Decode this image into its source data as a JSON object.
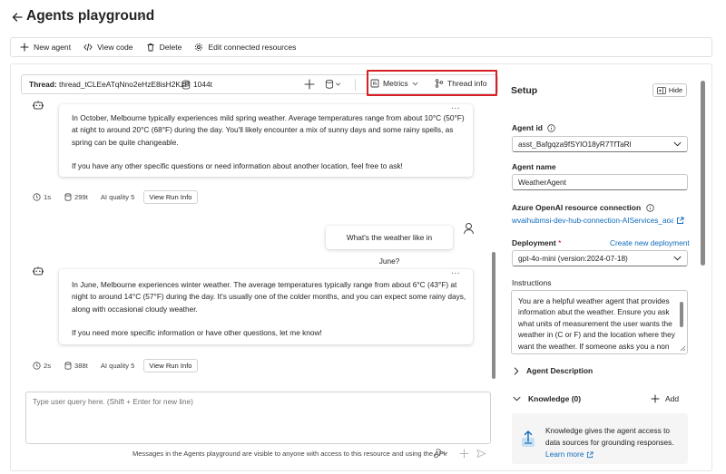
{
  "header": {
    "title": "Agents playground"
  },
  "toolbar": {
    "new_agent": "New agent",
    "view_code": "View code",
    "delete": "Delete",
    "edit_resources": "Edit connected resources"
  },
  "thread": {
    "label": "Thread:",
    "id": "thread_tCLEeATqNno2eHzE8isH2KzP",
    "tokens": "1044t",
    "metrics": "Metrics",
    "thread_info": "Thread info"
  },
  "messages": [
    {
      "role": "assistant",
      "more": "...",
      "paragraphs": [
        [
          "In October, Melbourne typically experiences mild spring weather. Average temperatures range from about 10°C (50°F)",
          "at night to around 20°C (68°F) during the day. You'll likely encounter a mix of sunny days and some rainy spells, as",
          "spring can be quite changeable."
        ],
        [
          "If you have any other specific questions or need information about another location, feel free to ask!"
        ]
      ],
      "duration": "1s",
      "tokens": "299t",
      "ai_quality": "AI quality 5",
      "run_info": "View Run Info"
    },
    {
      "role": "user",
      "text": "What's the weather like in June?"
    },
    {
      "role": "assistant",
      "more": "...",
      "paragraphs": [
        [
          "In June, Melbourne experiences winter weather. The average temperatures typically range from about 6°C (43°F) at",
          "night to around 14°C (57°F) during the day. It's usually one of the colder months, and you can expect some rainy days,",
          "along with occasional cloudy weather."
        ],
        [
          "If you need more specific information or have other questions, let me know!"
        ]
      ],
      "duration": "2s",
      "tokens": "388t",
      "ai_quality": "AI quality 5",
      "run_info": "View Run Info"
    }
  ],
  "input": {
    "placeholder": "Type user query here. (Shift + Enter for new line)",
    "disclaimer": "Messages in the Agents playground are visible to anyone with access to this resource and using the API."
  },
  "setup": {
    "title": "Setup",
    "hide": "Hide",
    "agent_id_label": "Agent id",
    "agent_id": "asst_Bafgqza9fSYlO18yR7TfTaRl",
    "agent_name_label": "Agent name",
    "agent_name": "WeatherAgent",
    "connection_label": "Azure OpenAI resource connection",
    "connection": "wvaihubmsi-dev-hub-connection-AIServices_aoai",
    "deployment_label": "Deployment",
    "required_mark": "*",
    "create_deployment": "Create new deployment",
    "deployment": "gpt-4o-mini (version:2024-07-18)",
    "instructions_label": "Instructions",
    "instructions": "You are a helpful weather agent that provides information abut the weather. Ensure you ask what units of measurement the user wants the weather in (C or F) and the location where they want the weather. If someone asks you a non",
    "agent_description": "Agent Description",
    "knowledge": "Knowledge (0)",
    "add": "Add",
    "knowledge_text": "Knowledge gives the agent access to data sources for grounding responses.",
    "learn_more": "Learn more"
  },
  "colors": {
    "accent": "#0f6cbd",
    "highlight": "#d71f26",
    "text": "#242424"
  }
}
